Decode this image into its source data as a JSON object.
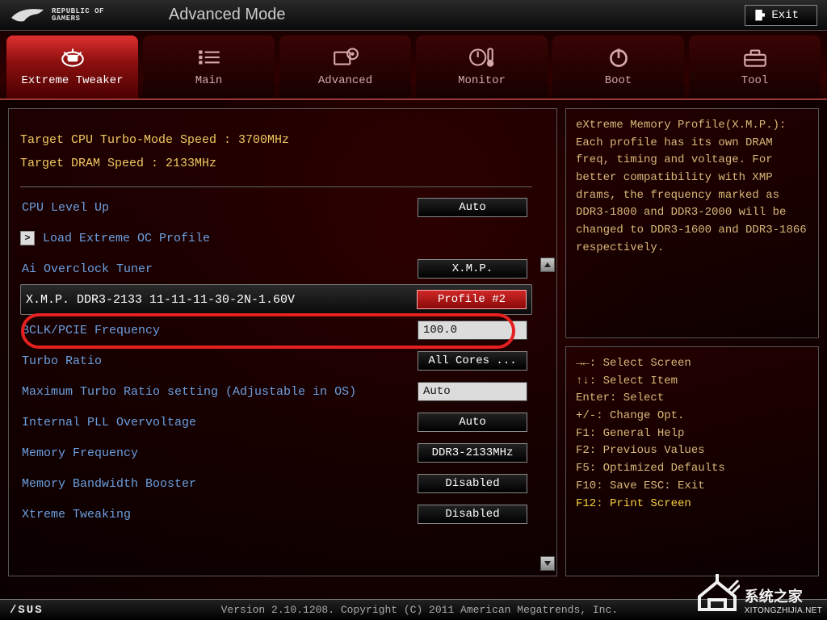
{
  "header": {
    "brand": "REPUBLIC OF\nGAMERS",
    "mode": "Advanced Mode",
    "exit": "Exit"
  },
  "tabs": [
    {
      "label": "Extreme Tweaker",
      "icon": "chip"
    },
    {
      "label": "Main",
      "icon": "list"
    },
    {
      "label": "Advanced",
      "icon": "gear"
    },
    {
      "label": "Monitor",
      "icon": "thermo"
    },
    {
      "label": "Boot",
      "icon": "power"
    },
    {
      "label": "Tool",
      "icon": "toolbox"
    }
  ],
  "active_tab": 0,
  "targets": {
    "cpu": "Target CPU Turbo-Mode Speed : 3700MHz",
    "dram": "Target DRAM Speed : 2133MHz"
  },
  "rows": [
    {
      "label": "CPU Level Up",
      "value": "Auto",
      "type": "select"
    },
    {
      "label": "Load Extreme OC Profile",
      "type": "link"
    },
    {
      "label": "Ai Overclock Tuner",
      "value": "X.M.P.",
      "type": "select"
    },
    {
      "label": "X.M.P. DDR3-2133 11-11-11-30-2N-1.60V",
      "value": "Profile #2",
      "type": "select",
      "highlight": true
    },
    {
      "label": "BCLK/PCIE Frequency",
      "value": "100.0",
      "type": "input"
    },
    {
      "label": "Turbo Ratio",
      "value": "All Cores ...",
      "type": "select"
    },
    {
      "label": "Maximum Turbo Ratio setting (Adjustable in OS)",
      "value": "Auto",
      "type": "input"
    },
    {
      "label": "Internal PLL Overvoltage",
      "value": "Auto",
      "type": "select"
    },
    {
      "label": "Memory Frequency",
      "value": "DDR3-2133MHz",
      "type": "select"
    },
    {
      "label": "Memory Bandwidth Booster",
      "value": "Disabled",
      "type": "select"
    },
    {
      "label": "Xtreme Tweaking",
      "value": "Disabled",
      "type": "select"
    }
  ],
  "help": "eXtreme Memory Profile(X.M.P.): Each profile has its own DRAM freq, timing and voltage. For better compatibility with XMP drams, the frequency marked as DDR3-1800 and DDR3-2000 will be changed to DDR3-1600 and DDR3-1866 respectively.",
  "keys": [
    "→←: Select Screen",
    "↑↓: Select Item",
    "Enter: Select",
    "+/-: Change Opt.",
    "F1: General Help",
    "F2: Previous Values",
    "F5: Optimized Defaults",
    "F10: Save  ESC: Exit"
  ],
  "keys_f12": "F12: Print Screen",
  "footer": {
    "brand": "/SUS",
    "text": "Version 2.10.1208. Copyright (C) 2011 American Megatrends, Inc."
  },
  "watermark": {
    "cn": "系统之家",
    "url": "XITONGZHIJIA.NET"
  }
}
